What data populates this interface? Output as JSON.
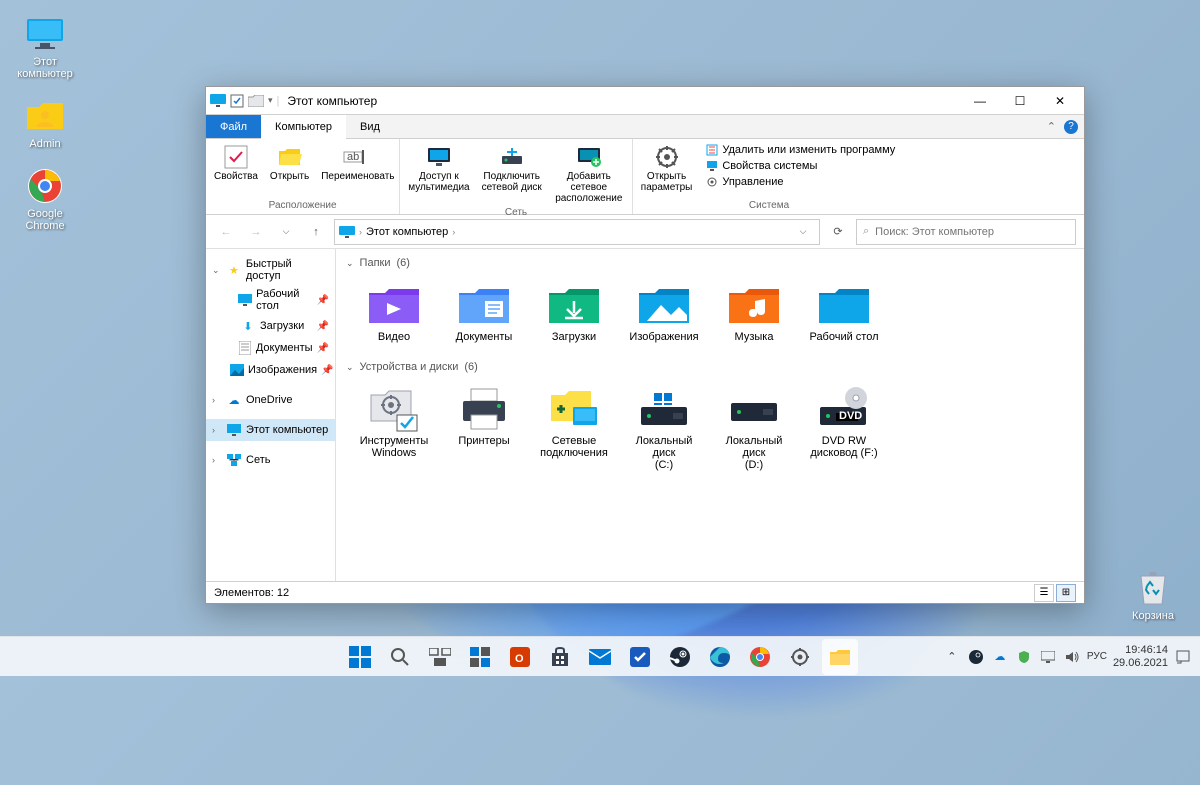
{
  "desktop": {
    "left_icons": [
      {
        "name": "this-pc",
        "label": "Этот\nкомпьютер"
      },
      {
        "name": "admin",
        "label": "Admin"
      },
      {
        "name": "chrome",
        "label": "Google\nChrome"
      }
    ],
    "recycle_label": "Корзина"
  },
  "window": {
    "title": "Этот компьютер",
    "tabs": {
      "file": "Файл",
      "computer": "Компьютер",
      "view": "Вид"
    },
    "ribbon": {
      "g1": {
        "label": "Расположение",
        "items": [
          "Свойства",
          "Открыть",
          "Переименовать"
        ]
      },
      "g2": {
        "label": "Сеть",
        "items": [
          "Доступ к\nмультимедиа",
          "Подключить\nсетевой диск",
          "Добавить сетевое\nрасположение"
        ]
      },
      "g3": {
        "label": "Система",
        "main": "Открыть\nпараметры",
        "links": [
          "Удалить или изменить программу",
          "Свойства системы",
          "Управление"
        ]
      }
    },
    "breadcrumb": "Этот компьютер",
    "search_placeholder": "Поиск: Этот компьютер",
    "sidebar": {
      "quick": "Быстрый доступ",
      "items": [
        "Рабочий стол",
        "Загрузки",
        "Документы",
        "Изображения"
      ],
      "onedrive": "OneDrive",
      "thispc": "Этот компьютер",
      "network": "Сеть"
    },
    "groups": {
      "folders": {
        "label": "Папки",
        "count": "(6)",
        "items": [
          "Видео",
          "Документы",
          "Загрузки",
          "Изображения",
          "Музыка",
          "Рабочий стол"
        ]
      },
      "devices": {
        "label": "Устройства и диски",
        "count": "(6)",
        "items": [
          "Инструменты\nWindows",
          "Принтеры",
          "Сетевые\nподключения",
          "Локальный диск\n(C:)",
          "Локальный диск\n(D:)",
          "DVD RW\nдисковод (F:)"
        ]
      }
    },
    "status": "Элементов: 12"
  },
  "taskbar": {
    "lang": "РУС",
    "time": "19:46:14",
    "date": "29.06.2021"
  }
}
